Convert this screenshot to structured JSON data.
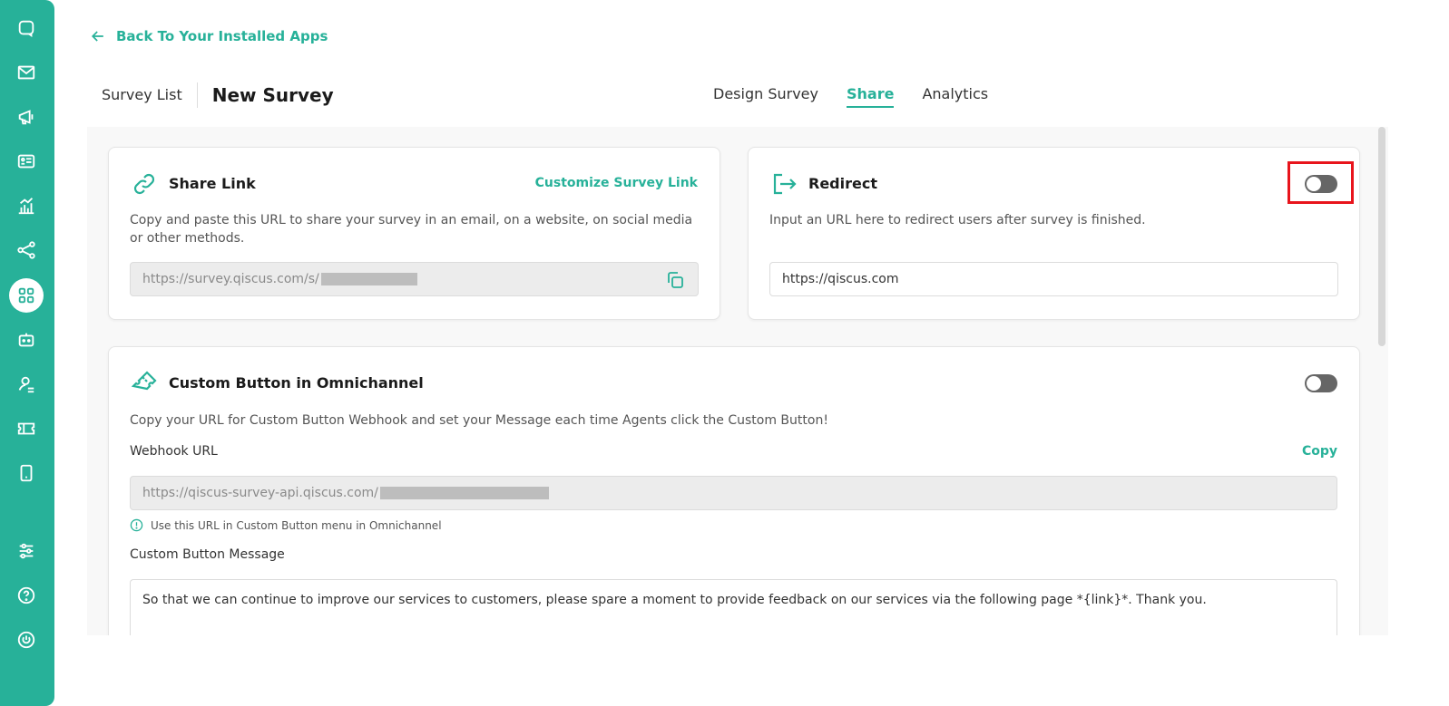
{
  "sidebar": {
    "items": [
      {
        "icon": "chat-icon"
      },
      {
        "icon": "mail-icon"
      },
      {
        "icon": "megaphone-icon"
      },
      {
        "icon": "contact-card-icon"
      },
      {
        "icon": "analytics-icon"
      },
      {
        "icon": "flow-icon"
      },
      {
        "icon": "apps-icon"
      },
      {
        "icon": "bot-icon"
      },
      {
        "icon": "agent-icon"
      },
      {
        "icon": "ticket-icon"
      },
      {
        "icon": "mobile-icon"
      },
      {
        "icon": "settings-icon"
      },
      {
        "icon": "help-icon"
      },
      {
        "icon": "power-icon"
      }
    ],
    "color": "#27b199"
  },
  "back_link": "Back To Your Installed Apps",
  "breadcrumb": {
    "list": "Survey List",
    "title": "New Survey"
  },
  "tabs": [
    {
      "label": "Design Survey",
      "active": false
    },
    {
      "label": "Share",
      "active": true
    },
    {
      "label": "Analytics",
      "active": false
    }
  ],
  "share_link": {
    "title": "Share Link",
    "customize": "Customize Survey Link",
    "description": "Copy and paste this URL to share your survey in an email, on a website, on social media or other methods.",
    "url": "https://survey.qiscus.com/s/"
  },
  "redirect": {
    "title": "Redirect",
    "description": "Input an URL here to redirect users after survey is finished.",
    "url": "https://qiscus.com",
    "enabled": false
  },
  "custom_button": {
    "title": "Custom Button in Omnichannel",
    "description": "Copy your URL for Custom Button Webhook and set your Message each time Agents click the Custom Button!",
    "webhook_label": "Webhook URL",
    "copy_label": "Copy",
    "webhook_url": "https://qiscus-survey-api.qiscus.com/",
    "hint": "Use this URL in Custom Button menu in Omnichannel",
    "message_label": "Custom Button Message",
    "message": "So that we can continue to improve our services to customers, please spare a moment to provide feedback on our services via the following page *{link}*. Thank you.",
    "enabled": false
  },
  "accent_color": "#27b199",
  "highlight_color": "#e8141c"
}
